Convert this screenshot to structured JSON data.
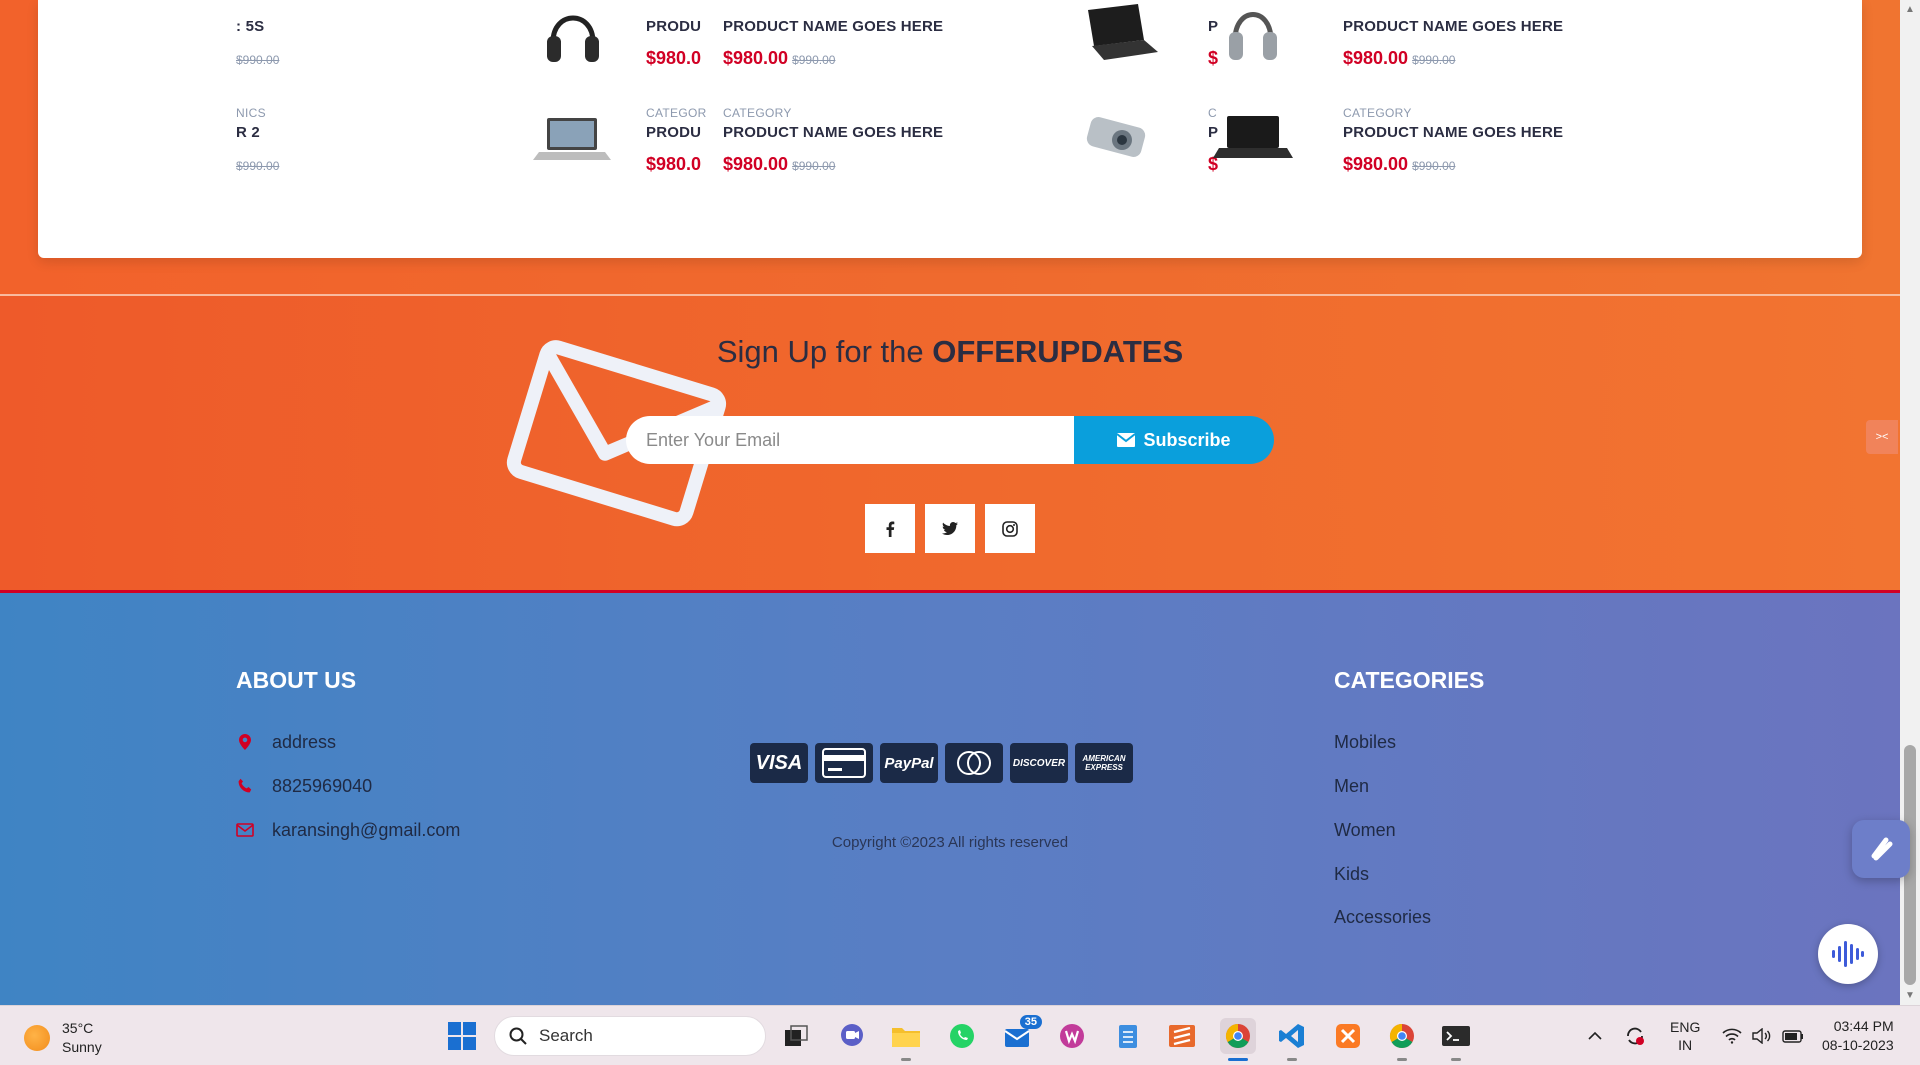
{
  "products": {
    "left_partial": [
      {
        "category": "",
        "name": ": 5S",
        "price": "",
        "old_price": "$990.00"
      },
      {
        "category": "NICS",
        "name": "R 2",
        "price": "",
        "old_price": "$990.00"
      }
    ],
    "col2": [
      {
        "category": "",
        "name": "PRODU",
        "price": "$980.0",
        "thumb": "headphones"
      },
      {
        "category": "CATEGOR",
        "name": "PRODU",
        "price": "$980.0",
        "thumb": "laptop"
      }
    ],
    "col3": [
      {
        "category": "",
        "name": "PRODUCT NAME GOES HERE",
        "price": "$980.00",
        "old_price": "$990.00"
      },
      {
        "category": "CATEGORY",
        "name": "PRODUCT NAME GOES HERE",
        "price": "$980.00",
        "old_price": "$990.00"
      }
    ],
    "col4": [
      {
        "category": "",
        "name": "P",
        "price": "$",
        "thumb": "laptop-dark"
      },
      {
        "category": "C",
        "name": "P",
        "price": "$",
        "thumb": "camera"
      }
    ],
    "col5": [
      {
        "category": "",
        "name": "PRODUCT NAME GOES HERE",
        "price": "$980.00",
        "old_price": "$990.00",
        "thumb": "headphones-silver"
      },
      {
        "category": "CATEGORY",
        "name": "PRODUCT NAME GOES HERE",
        "price": "$980.00",
        "old_price": "$990.00",
        "thumb": "laptop-black"
      }
    ]
  },
  "newsletter": {
    "title_prefix": "Sign Up for the ",
    "title_bold": "OFFERUPDATES",
    "email_placeholder": "Enter Your Email",
    "subscribe_label": "Subscribe",
    "social": [
      "facebook-icon",
      "twitter-icon",
      "instagram-icon"
    ]
  },
  "footer": {
    "about_title": "ABOUT US",
    "address": "address",
    "phone": "8825969040",
    "email": "karansingh@gmail.com",
    "payments": [
      "VISA",
      "",
      "PayPal",
      "",
      "DISCOVER",
      "AMERICAN EXPRESS"
    ],
    "copyright": "Copyright ©2023 All rights reserved",
    "categories_title": "CATEGORIES",
    "categories": [
      "Mobiles",
      "Men",
      "Women",
      "Kids",
      "Accessories"
    ]
  },
  "taskbar": {
    "temperature": "35°C",
    "weather": "Sunny",
    "search_label": "Search",
    "mail_badge": "35",
    "lang_top": "ENG",
    "lang_bottom": "IN",
    "time": "03:44 PM",
    "date": "08-10-2023"
  },
  "colors": {
    "accent_red": "#d10024",
    "subscribe_blue": "#0a9fdc",
    "orange": "#f06a2d",
    "footer_blue": "#4a82c4"
  }
}
